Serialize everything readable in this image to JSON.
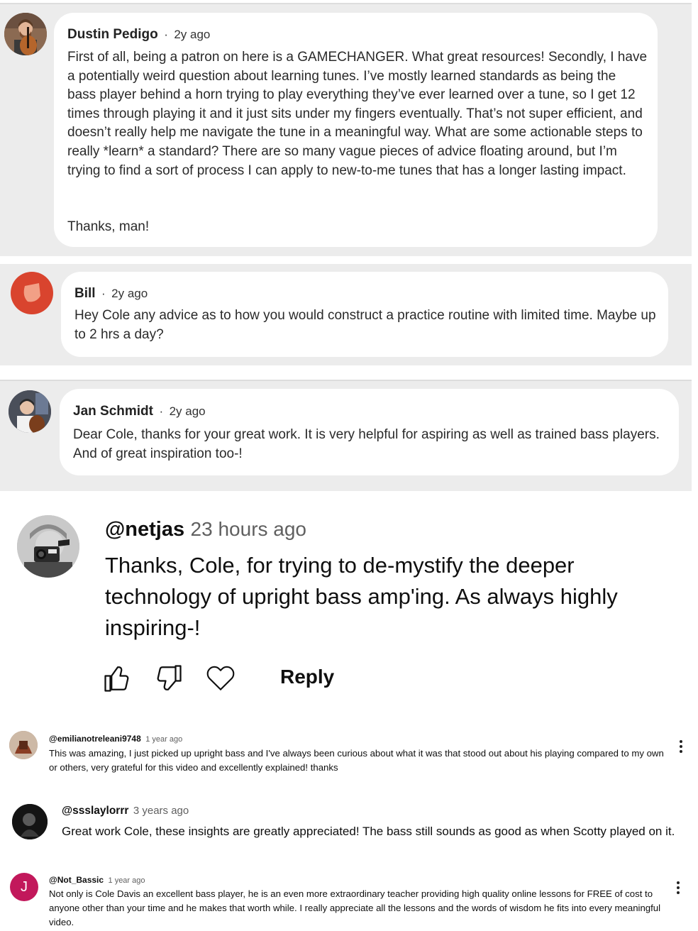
{
  "patreon_comments": [
    {
      "author": "Dustin Pedigo",
      "separator": "·",
      "time": "2y ago",
      "paragraphs": [
        "First of all, being a patron on here is a GAMECHANGER. What great resources! Secondly, I have a potentially weird question about learning tunes. I’ve mostly learned standards as being the bass player behind a horn trying to play everything they’ve ever learned over a tune, so I get 12 times through playing it and it just sits under my fingers eventually. That’s not super efficient, and doesn’t really help me navigate the tune in a meaningful way. What are some actionable steps to really *learn* a standard? There are so many vague pieces of advice floating around, but I’m trying to find a sort of process I can apply to new-to-me tunes that has a longer lasting impact.",
        "Thanks, man!"
      ]
    },
    {
      "author": "Bill",
      "separator": "·",
      "time": "2y ago",
      "paragraphs": [
        "Hey Cole any advice as to how you would construct a practice routine with limited time. Maybe up to 2 hrs a day?"
      ],
      "avatar_color": "#d9442e"
    },
    {
      "author": "Jan Schmidt",
      "separator": "·",
      "time": "2y ago",
      "paragraphs": [
        "Dear Cole, thanks for your great work. It is very helpful for aspiring as well as trained bass players. And of great inspiration too-!"
      ]
    }
  ],
  "featured_comment": {
    "handle": "@netjas",
    "time": "23 hours ago",
    "text": "Thanks, Cole, for trying to de-mystify the deeper technology of upright bass amp'ing. As always highly inspiring-!",
    "actions": {
      "like_icon": "thumbs-up-icon",
      "dislike_icon": "thumbs-down-icon",
      "heart_icon": "heart-icon",
      "reply_label": "Reply"
    }
  },
  "youtube_comments": [
    {
      "handle": "@emilianotreleani9748",
      "time": "1 year ago",
      "text": "This was amazing, I just picked up upright bass and I've always been curious about what it was that stood out about his playing compared to my own or others, very grateful for this video and excellently explained! thanks"
    },
    {
      "handle": "@ssslaylorrr",
      "time": "3 years ago",
      "text": "Great work Cole, these insights are greatly appreciated! The bass still sounds as good as when Scotty played on it."
    },
    {
      "handle": "@Not_Bassic",
      "time": "1 year ago",
      "avatar_letter": "J",
      "avatar_color": "#c2185b",
      "text": "Not only is Cole Davis an excellent bass player, he is an even more extraordinary teacher providing high quality online lessons for FREE of cost to anyone other than your time and he makes that worth while. I really appreciate all the lessons and the words of wisdom he fits into every meaningful video."
    }
  ]
}
